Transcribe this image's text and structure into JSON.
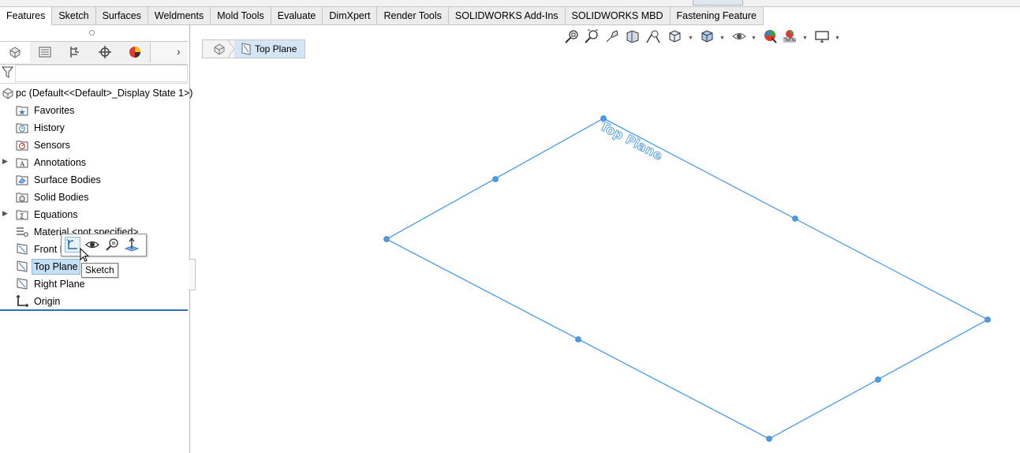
{
  "tabs": [
    "Features",
    "Sketch",
    "Surfaces",
    "Weldments",
    "Mold Tools",
    "Evaluate",
    "DimXpert",
    "Render Tools",
    "SOLIDWORKS Add-Ins",
    "SOLIDWORKS MBD",
    "Fastening Feature"
  ],
  "panel_tabs": [
    "feature-manager-icon",
    "property-manager-icon",
    "configuration-manager-icon",
    "dimxpert-manager-icon",
    "display-manager-icon"
  ],
  "tree": {
    "root": "pc  (Default<<Default>_Display State 1>)",
    "items": [
      {
        "label": "Favorites",
        "icon": "favorites-folder-icon"
      },
      {
        "label": "History",
        "icon": "history-folder-icon"
      },
      {
        "label": "Sensors",
        "icon": "sensors-folder-icon"
      },
      {
        "label": "Annotations",
        "icon": "annotations-folder-icon"
      },
      {
        "label": "Surface Bodies",
        "icon": "surface-bodies-folder-icon"
      },
      {
        "label": "Solid Bodies",
        "icon": "solid-bodies-folder-icon"
      },
      {
        "label": "Equations",
        "icon": "equations-folder-icon"
      },
      {
        "label": "Material <not specified>",
        "icon": "material-icon"
      },
      {
        "label": "Front P",
        "icon": "plane-icon"
      },
      {
        "label": "Top Plane",
        "icon": "plane-icon"
      },
      {
        "label": "Right Plane",
        "icon": "plane-icon"
      },
      {
        "label": "Origin",
        "icon": "origin-icon"
      }
    ]
  },
  "context_toolbar": {
    "buttons": [
      "sketch-icon",
      "show-hide-icon",
      "zoom-to-selection-icon",
      "normal-to-icon"
    ],
    "tooltip": "Sketch"
  },
  "breadcrumb": {
    "label": "Top Plane"
  },
  "graphics": {
    "plane_label": "Top Plane",
    "accent": "#4a9be8"
  },
  "hud_icons": [
    "zoom-to-fit-icon",
    "zoom-to-area-icon",
    "previous-view-icon",
    "section-view-icon",
    "dynamic-annotation-icon",
    "view-orientation-icon",
    "display-style-icon",
    "hide-show-items-icon",
    "edit-appearance-icon",
    "apply-scene-icon",
    "view-settings-icon"
  ]
}
